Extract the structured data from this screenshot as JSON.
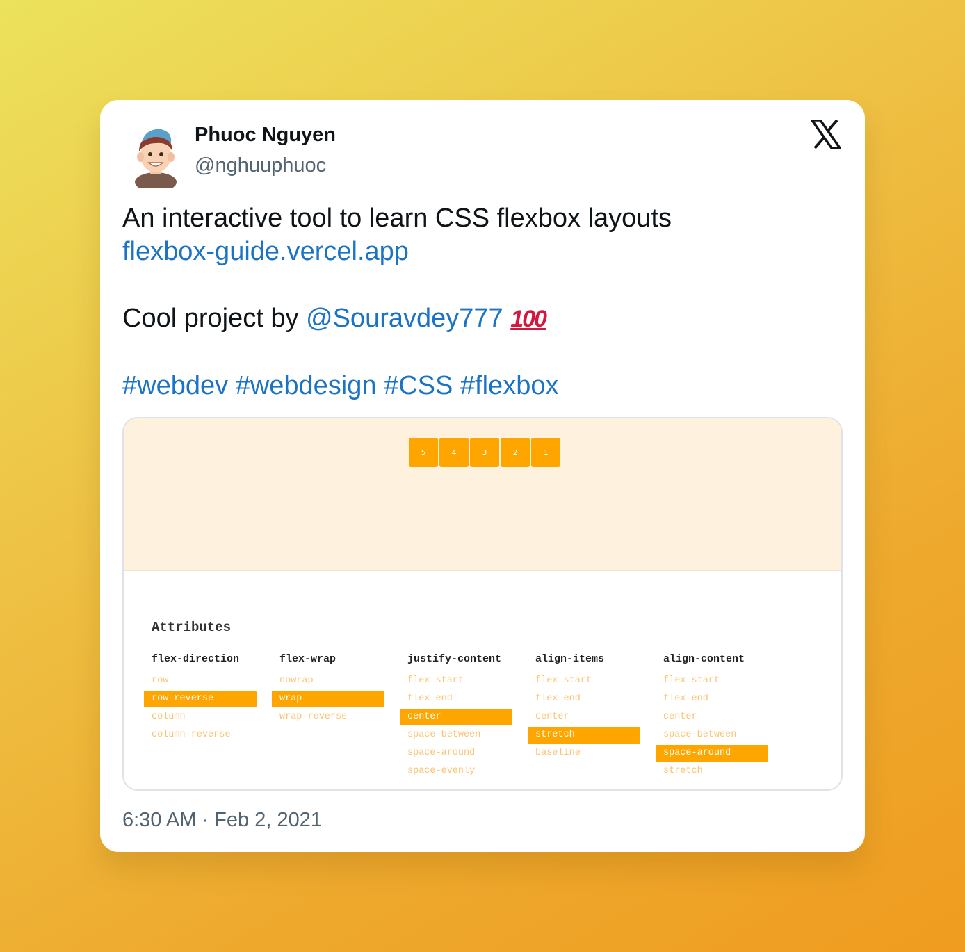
{
  "author": {
    "name": "Phuoc Nguyen",
    "handle": "@nghuuphuoc"
  },
  "icons": {
    "logo": "x-logo-icon",
    "avatar": "avatar-illustration"
  },
  "tweet": {
    "line1": "An interactive tool to learn CSS flexbox layouts",
    "link": "flexbox-guide.vercel.app",
    "credit_prefix": "Cool project by ",
    "mention": "@Souravdey777",
    "emoji": "100",
    "hashtags": [
      "#webdev",
      "#webdesign",
      "#CSS",
      "#flexbox"
    ]
  },
  "media": {
    "preview_boxes": [
      "5",
      "4",
      "3",
      "2",
      "1"
    ],
    "attributes_title": "Attributes",
    "groups": [
      {
        "name": "flex-direction",
        "options": [
          "row",
          "row-reverse",
          "column",
          "column-reverse"
        ],
        "selected": "row-reverse"
      },
      {
        "name": "flex-wrap",
        "options": [
          "nowrap",
          "wrap",
          "wrap-reverse"
        ],
        "selected": "wrap"
      },
      {
        "name": "justify-content",
        "options": [
          "flex-start",
          "flex-end",
          "center",
          "space-between",
          "space-around",
          "space-evenly"
        ],
        "selected": "center"
      },
      {
        "name": "align-items",
        "options": [
          "flex-start",
          "flex-end",
          "center",
          "stretch",
          "baseline"
        ],
        "selected": "stretch"
      },
      {
        "name": "align-content",
        "options": [
          "flex-start",
          "flex-end",
          "center",
          "space-between",
          "space-around",
          "stretch"
        ],
        "selected": "space-around"
      }
    ]
  },
  "timestamp": "6:30 AM · Feb 2, 2021",
  "colors": {
    "link": "#1a73c4",
    "accent_orange": "#ffa500",
    "preview_bg": "#fef1de",
    "option_text": "#fbc473"
  }
}
